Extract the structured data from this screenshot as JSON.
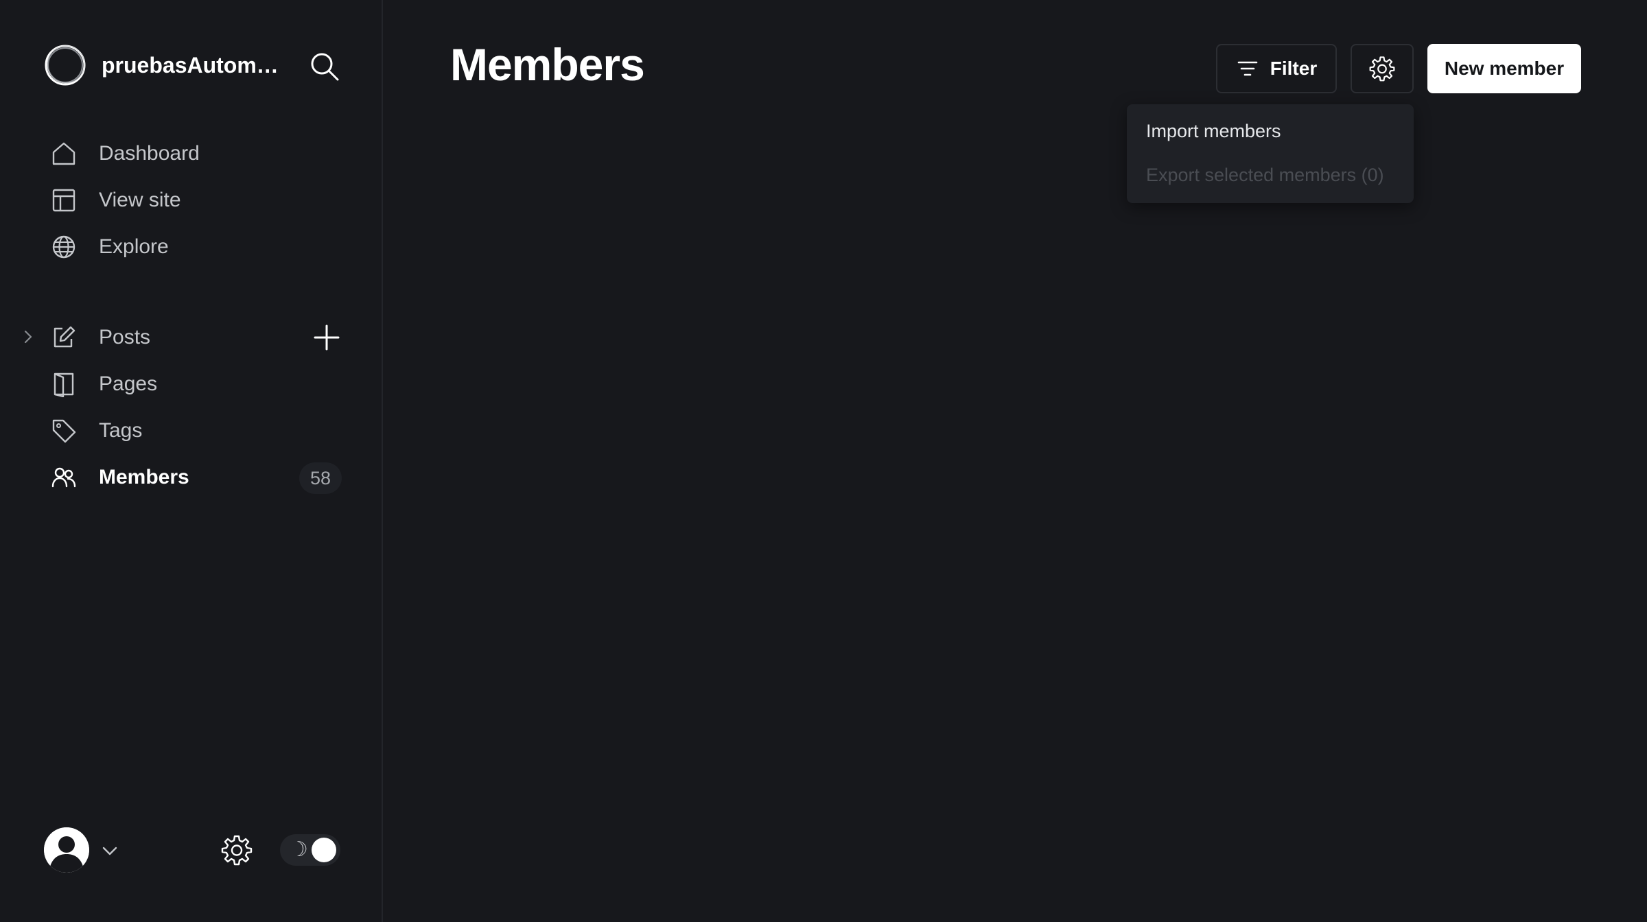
{
  "brand": {
    "name": "pruebasAutoma..."
  },
  "nav": {
    "dashboard": "Dashboard",
    "view_site": "View site",
    "explore": "Explore",
    "posts": "Posts",
    "pages": "Pages",
    "tags": "Tags",
    "members": "Members",
    "members_count": "58"
  },
  "header": {
    "title": "Members",
    "filter_label": "Filter",
    "new_member_label": "New member"
  },
  "dropdown": {
    "import": "Import members",
    "export": "Export selected members (0)"
  },
  "footer": {
    "theme_icon": "☽"
  },
  "colors": {
    "background": "#17181c",
    "sidebar_border": "#23252a",
    "primary_button": "#ffffff",
    "dropdown_bg": "#1f2126",
    "muted_text": "#4a4d53"
  }
}
